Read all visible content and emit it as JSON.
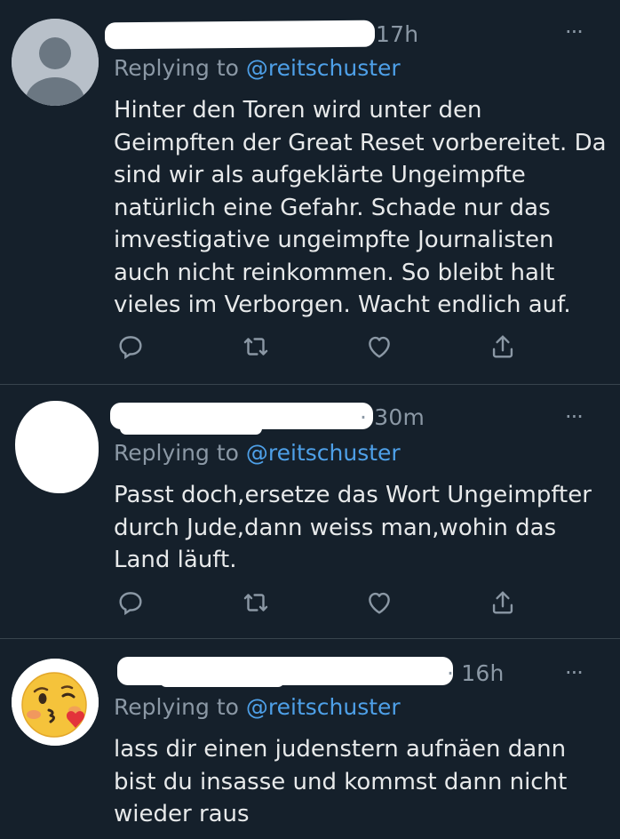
{
  "tweets": [
    {
      "time": "17h",
      "more": "···",
      "replying_prefix": "Replying to",
      "handle": "@reitschuster",
      "text": "Hinter den Toren wird unter den Geimpften der Great Reset vorbereitet. Da sind wir als aufgeklärte Ungeimpfte natürlich eine Gefahr. Schade nur das imvestigative ungeimpfte Journalisten auch nicht reinkommen. So bleibt halt vieles im Verborgen. Wacht endlich auf.",
      "avatar": "default-profile-icon"
    },
    {
      "time": "· 30m",
      "more": "···",
      "replying_prefix": "Replying to",
      "handle": "@reitschuster",
      "text": "Passt doch,ersetze das Wort Ungeimpfter durch Jude,dann weiss man,wohin das Land läuft.",
      "avatar": "redacted-avatar"
    },
    {
      "time": "· 16h",
      "more": "···",
      "replying_prefix": "Replying to",
      "handle": "@reitschuster",
      "text": "lass dir einen judenstern aufnäen dann bist du insasse und kommst dann nicht wieder raus",
      "avatar": "kissing-face-emoji"
    }
  ],
  "icons": [
    "reply-icon",
    "retweet-icon",
    "like-icon",
    "share-icon"
  ],
  "colors": {
    "background": "#15202b",
    "text": "#e7e9ea",
    "muted": "#8b98a5",
    "link": "#4ea0e8",
    "divider": "#38444d"
  }
}
